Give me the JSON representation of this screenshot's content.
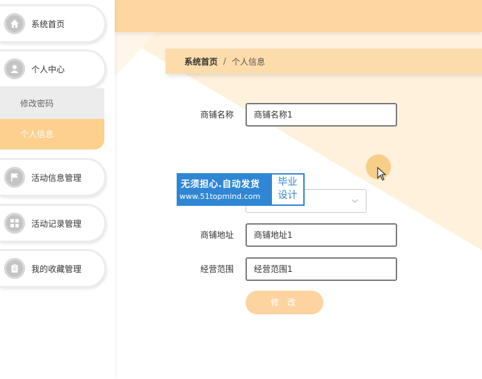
{
  "sidebar": {
    "items": [
      {
        "label": "系统首页",
        "icon": "home-icon"
      },
      {
        "label": "个人中心",
        "icon": "user-icon"
      },
      {
        "label": "活动信息管理",
        "icon": "flag-icon"
      },
      {
        "label": "活动记录管理",
        "icon": "grid-icon"
      },
      {
        "label": "我的收藏管理",
        "icon": "clipboard-icon"
      }
    ],
    "submenu": [
      {
        "label": "修改密码"
      },
      {
        "label": "个人信息"
      }
    ]
  },
  "breadcrumb": {
    "home": "系统首页",
    "separator": "/",
    "current": "个人信息"
  },
  "form": {
    "shop_name": {
      "label": "商铺名称",
      "value": "商铺名称1"
    },
    "shop_address": {
      "label": "商铺地址",
      "value": "商铺地址1"
    },
    "business_scope": {
      "label": "经营范围",
      "value": "经营范围1"
    },
    "submit_label": "修 改"
  },
  "watermark": {
    "line1": "无须担心.自动发货",
    "line2": "www.51topmind.com",
    "badge_line1": "毕业",
    "badge_line2": "设计"
  },
  "colors": {
    "accent": "#fdd08e",
    "topbar": "#fdd6a2",
    "watermark_blue": "#2f86d4"
  }
}
